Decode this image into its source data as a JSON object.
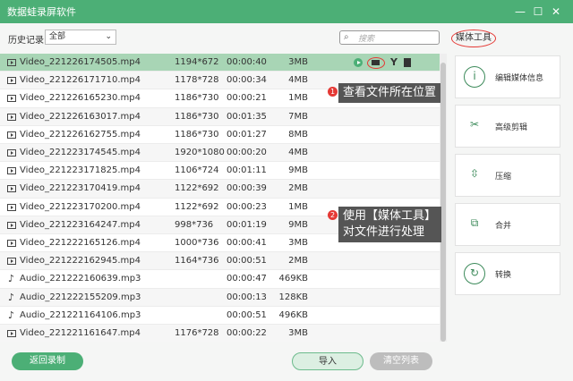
{
  "app": {
    "title": "数据蛙录屏软件"
  },
  "toolbar": {
    "history_label": "历史记录",
    "filter_value": "全部",
    "search_placeholder": "搜索"
  },
  "files": [
    {
      "type": "video",
      "name": "Video_221226174505.mp4",
      "res": "1194*672",
      "dur": "00:00:40",
      "size": "3MB",
      "selected": true
    },
    {
      "type": "video",
      "name": "Video_221226171710.mp4",
      "res": "1178*728",
      "dur": "00:00:34",
      "size": "4MB"
    },
    {
      "type": "video",
      "name": "Video_221226165230.mp4",
      "res": "1186*730",
      "dur": "00:00:21",
      "size": "1MB"
    },
    {
      "type": "video",
      "name": "Video_221226163017.mp4",
      "res": "1186*730",
      "dur": "00:01:35",
      "size": "7MB"
    },
    {
      "type": "video",
      "name": "Video_221226162755.mp4",
      "res": "1186*730",
      "dur": "00:01:27",
      "size": "8MB"
    },
    {
      "type": "video",
      "name": "Video_221223174545.mp4",
      "res": "1920*1080",
      "dur": "00:00:20",
      "size": "4MB"
    },
    {
      "type": "video",
      "name": "Video_221223171825.mp4",
      "res": "1106*724",
      "dur": "00:01:11",
      "size": "9MB"
    },
    {
      "type": "video",
      "name": "Video_221223170419.mp4",
      "res": "1122*692",
      "dur": "00:00:39",
      "size": "2MB"
    },
    {
      "type": "video",
      "name": "Video_221223170200.mp4",
      "res": "1122*692",
      "dur": "00:00:23",
      "size": "1MB"
    },
    {
      "type": "video",
      "name": "Video_221223164247.mp4",
      "res": "998*736",
      "dur": "00:01:19",
      "size": "9MB"
    },
    {
      "type": "video",
      "name": "Video_221222165126.mp4",
      "res": "1000*736",
      "dur": "00:00:41",
      "size": "3MB"
    },
    {
      "type": "video",
      "name": "Video_221222162945.mp4",
      "res": "1164*736",
      "dur": "00:00:51",
      "size": "2MB"
    },
    {
      "type": "audio",
      "name": "Audio_221222160639.mp3",
      "res": "",
      "dur": "00:00:47",
      "size": "469KB"
    },
    {
      "type": "audio",
      "name": "Audio_221222155209.mp3",
      "res": "",
      "dur": "00:00:13",
      "size": "128KB"
    },
    {
      "type": "audio",
      "name": "Audio_221221164106.mp3",
      "res": "",
      "dur": "00:00:51",
      "size": "496KB"
    },
    {
      "type": "video",
      "name": "Video_221221161647.mp4",
      "res": "1176*728",
      "dur": "00:00:22",
      "size": "3MB"
    }
  ],
  "annotations": {
    "a1_num": "1",
    "a1_text": "查看文件所在位置",
    "a2_num": "2",
    "a2_line1": "使用【媒体工具】",
    "a2_line2": "对文件进行处理"
  },
  "media_tools": {
    "title": "媒体工具",
    "items": [
      {
        "label": "编辑媒体信息",
        "icon": "info-icon"
      },
      {
        "label": "高级剪辑",
        "icon": "scissors-icon"
      },
      {
        "label": "压缩",
        "icon": "compress-icon"
      },
      {
        "label": "合并",
        "icon": "merge-icon"
      },
      {
        "label": "转换",
        "icon": "convert-icon"
      }
    ]
  },
  "bottom": {
    "back_label": "返回录制",
    "import_label": "导入",
    "clear_label": "清空列表"
  },
  "colors": {
    "brand": "#4caf76",
    "selected_row": "#a8d5b5",
    "annotation_red": "#e53935"
  }
}
